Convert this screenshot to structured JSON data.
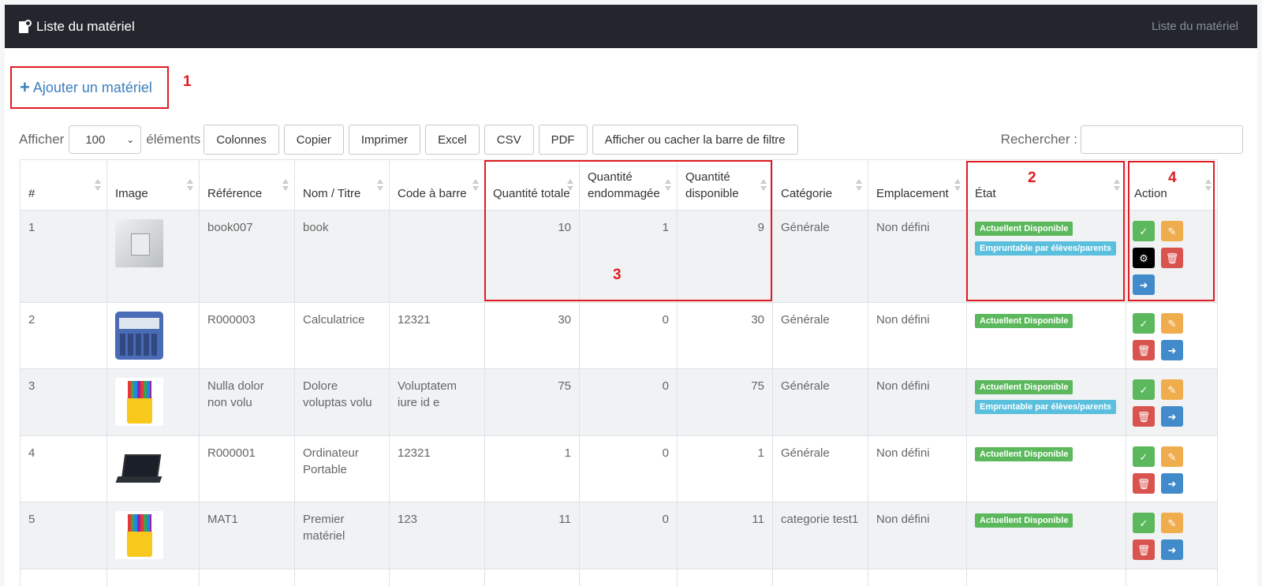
{
  "header": {
    "title": "Liste du matériel",
    "breadcrumb": "Liste du matériel"
  },
  "add_button": {
    "label": "Ajouter un matériel"
  },
  "annotations": [
    "1",
    "2",
    "3",
    "4"
  ],
  "length_control": {
    "prefix": "Afficher",
    "value": "100",
    "suffix": "éléments"
  },
  "buttons": [
    "Colonnes",
    "Copier",
    "Imprimer",
    "Excel",
    "CSV",
    "PDF",
    "Afficher ou cacher la barre de filtre"
  ],
  "search": {
    "label": "Rechercher :",
    "value": ""
  },
  "columns": [
    "#",
    "Image",
    "Référence",
    "Nom / Titre",
    "Code à barre",
    "Quantité totale",
    "Quantité endommagée",
    "Quantité disponible",
    "Catégorie",
    "Emplacement",
    "État",
    "Action"
  ],
  "rows": [
    {
      "id": "1",
      "image": "book-image",
      "ref": "book007",
      "name": "book",
      "barcode": "",
      "total": "10",
      "damaged": "1",
      "available": "9",
      "category": "Générale",
      "location": "Non défini",
      "badges": [
        "Actuellent Disponible",
        "Empruntable par élèves/parents"
      ]
    },
    {
      "id": "2",
      "image": "calculator-image",
      "ref": "R000003",
      "name": "Calculatrice",
      "barcode": "12321",
      "total": "30",
      "damaged": "0",
      "available": "30",
      "category": "Générale",
      "location": "Non défini",
      "badges": [
        "Actuellent Disponible"
      ]
    },
    {
      "id": "3",
      "image": "pens-image",
      "ref": "Nulla dolor non volu",
      "name": "Dolore voluptas volu",
      "barcode": "Voluptatem iure id e",
      "total": "75",
      "damaged": "0",
      "available": "75",
      "category": "Générale",
      "location": "Non défini",
      "badges": [
        "Actuellent Disponible",
        "Empruntable par élèves/parents"
      ]
    },
    {
      "id": "4",
      "image": "laptop-image",
      "ref": "R000001",
      "name": "Ordinateur Portable",
      "barcode": "12321",
      "total": "1",
      "damaged": "0",
      "available": "1",
      "category": "Générale",
      "location": "Non défini",
      "badges": [
        "Actuellent Disponible"
      ]
    },
    {
      "id": "5",
      "image": "pens-image",
      "ref": "MAT1",
      "name": "Premier matériel",
      "barcode": "123",
      "total": "11",
      "damaged": "0",
      "available": "11",
      "category": "categorie test1",
      "location": "Non défini",
      "badges": [
        "Actuellent Disponible"
      ]
    }
  ],
  "colors": {
    "header_bg": "#23272d",
    "link": "#3c7ebf",
    "annotation": "#e11b22",
    "badge_green": "#5cb85c",
    "badge_blue": "#5bc0de"
  }
}
